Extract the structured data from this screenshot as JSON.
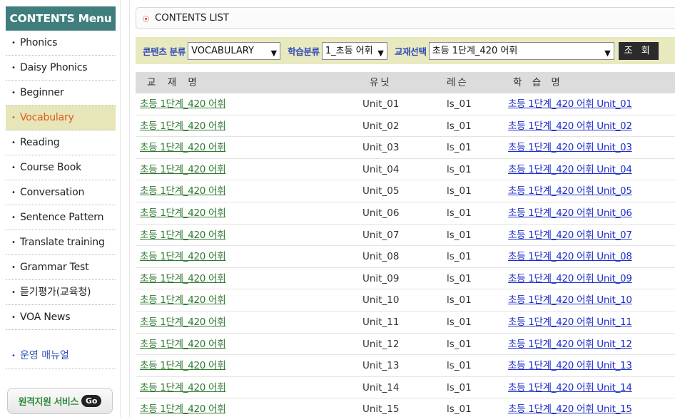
{
  "sidebar": {
    "header": "CONTENTS Menu",
    "items": [
      {
        "label": "Phonics",
        "active": false
      },
      {
        "label": "Daisy Phonics",
        "active": false
      },
      {
        "label": "Beginner",
        "active": false
      },
      {
        "label": "Vocabulary",
        "active": true
      },
      {
        "label": "Reading",
        "active": false
      },
      {
        "label": "Course Book",
        "active": false
      },
      {
        "label": "Conversation",
        "active": false
      },
      {
        "label": "Sentence Pattern",
        "active": false
      },
      {
        "label": "Translate training",
        "active": false
      },
      {
        "label": "Grammar Test",
        "active": false
      },
      {
        "label": "듣기평가(교육청)",
        "active": false
      },
      {
        "label": "VOA News",
        "active": false
      }
    ],
    "bullet": "•",
    "manual": "운영 매뉴얼",
    "remote_service": {
      "label": "원격지원 서비스",
      "go": "Go"
    }
  },
  "main": {
    "title": "CONTENTS LIST",
    "filters": {
      "content_label": "콘텐츠 분류",
      "content_value": "VOCABULARY",
      "study_label": "학습분류",
      "study_value": "1_초등 어휘",
      "book_label": "교재선택",
      "book_value": "초등 1단계_420 어휘",
      "search_button": "조 회"
    },
    "table": {
      "headers": {
        "book": "교 재 명",
        "unit": "유닛",
        "lesson": "레슨",
        "title": "학 습 명"
      },
      "rows": [
        {
          "book": "초등 1단계_420 어휘",
          "unit": "Unit_01",
          "lesson": "ls_01",
          "title": "초등 1단계_420 어휘 Unit_01"
        },
        {
          "book": "초등 1단계_420 어휘",
          "unit": "Unit_02",
          "lesson": "ls_01",
          "title": "초등 1단계_420 어휘 Unit_02"
        },
        {
          "book": "초등 1단계_420 어휘",
          "unit": "Unit_03",
          "lesson": "ls_01",
          "title": "초등 1단계_420 어휘 Unit_03"
        },
        {
          "book": "초등 1단계_420 어휘",
          "unit": "Unit_04",
          "lesson": "ls_01",
          "title": "초등 1단계_420 어휘 Unit_04"
        },
        {
          "book": "초등 1단계_420 어휘",
          "unit": "Unit_05",
          "lesson": "ls_01",
          "title": "초등 1단계_420 어휘 Unit_05"
        },
        {
          "book": "초등 1단계_420 어휘",
          "unit": "Unit_06",
          "lesson": "ls_01",
          "title": "초등 1단계_420 어휘 Unit_06"
        },
        {
          "book": "초등 1단계_420 어휘",
          "unit": "Unit_07",
          "lesson": "ls_01",
          "title": "초등 1단계_420 어휘 Unit_07"
        },
        {
          "book": "초등 1단계_420 어휘",
          "unit": "Unit_08",
          "lesson": "ls_01",
          "title": "초등 1단계_420 어휘 Unit_08"
        },
        {
          "book": "초등 1단계_420 어휘",
          "unit": "Unit_09",
          "lesson": "ls_01",
          "title": "초등 1단계_420 어휘 Unit_09"
        },
        {
          "book": "초등 1단계_420 어휘",
          "unit": "Unit_10",
          "lesson": "ls_01",
          "title": "초등 1단계_420 어휘 Unit_10"
        },
        {
          "book": "초등 1단계_420 어휘",
          "unit": "Unit_11",
          "lesson": "ls_01",
          "title": "초등 1단계_420 어휘 Unit_11"
        },
        {
          "book": "초등 1단계_420 어휘",
          "unit": "Unit_12",
          "lesson": "ls_01",
          "title": "초등 1단계_420 어휘 Unit_12"
        },
        {
          "book": "초등 1단계_420 어휘",
          "unit": "Unit_13",
          "lesson": "ls_01",
          "title": "초등 1단계_420 어휘 Unit_13"
        },
        {
          "book": "초등 1단계_420 어휘",
          "unit": "Unit_14",
          "lesson": "ls_01",
          "title": "초등 1단계_420 어휘 Unit_14"
        },
        {
          "book": "초등 1단계_420 어휘",
          "unit": "Unit_15",
          "lesson": "ls_01",
          "title": "초등 1단계_420 어휘 Unit_15"
        }
      ]
    }
  },
  "colors": {
    "menu_header_bg": "#3f7e7c",
    "active_bg": "#e6e6b8",
    "active_text": "#e05a1f",
    "filter_bg": "#e9e9c0",
    "filter_label": "#2d49b8",
    "book_link": "#2f7a2f",
    "title_link": "#1f2fc8"
  },
  "icons": {
    "title_marker": "red-dot-icon",
    "select_arrow": "chevron-down-icon"
  }
}
